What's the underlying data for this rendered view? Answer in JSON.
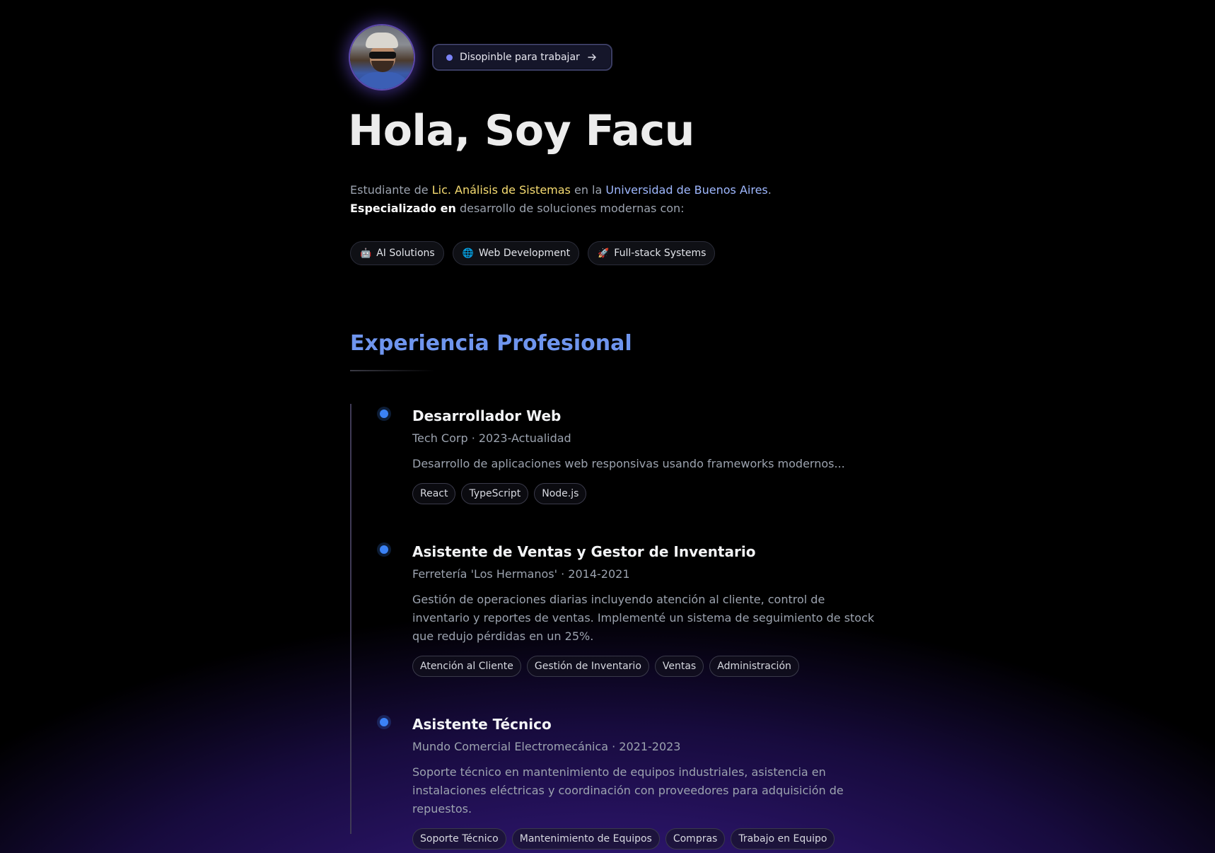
{
  "header": {
    "status_text": "Disopinble para trabajar",
    "title": "Hola, Soy Facu"
  },
  "intro": {
    "p1": "Estudiante de ",
    "degree": "Lic. Análisis de Sistemas",
    "p2": " en la ",
    "university": "Universidad de Buenos Aires",
    "p3": ". ",
    "specialized": "Especializado en",
    "p4": " desarrollo de soluciones modernas con:"
  },
  "skills": [
    {
      "emoji": "🤖",
      "label": "AI Solutions"
    },
    {
      "emoji": "🌐",
      "label": "Web Development"
    },
    {
      "emoji": "🚀",
      "label": "Full-stack Systems"
    }
  ],
  "experience": {
    "title": "Experiencia Profesional",
    "items": [
      {
        "title": "Desarrollador Web",
        "meta": "Tech Corp · 2023-Actualidad",
        "description": "Desarrollo de aplicaciones web responsivas usando frameworks modernos...",
        "tags": [
          "React",
          "TypeScript",
          "Node.js"
        ]
      },
      {
        "title": "Asistente de Ventas y Gestor de Inventario",
        "meta": "Ferretería 'Los Hermanos' · 2014-2021",
        "description": "Gestión de operaciones diarias incluyendo atención al cliente, control de inventario y reportes de ventas. Implementé un sistema de seguimiento de stock que redujo pérdidas en un 25%.",
        "tags": [
          "Atención al Cliente",
          "Gestión de Inventario",
          "Ventas",
          "Administración"
        ]
      },
      {
        "title": "Asistente Técnico",
        "meta": "Mundo Comercial Electromecánica · 2021-2023",
        "description": "Soporte técnico en mantenimiento de equipos industriales, asistencia en instalaciones eléctricas y coordinación con proveedores para adquisición de repuestos.",
        "tags": [
          "Soporte Técnico",
          "Mantenimiento de Equipos",
          "Compras",
          "Trabajo en Equipo"
        ]
      }
    ]
  },
  "colors": {
    "accent_blue": "#6f95ee",
    "highlight_yellow": "#f7dd72",
    "highlight_blue": "#9fb8ff",
    "timeline_dot": "#3b82f6",
    "status_dot": "#7b83f6"
  },
  "icons": {
    "status_arrow": "arrow-right-icon"
  }
}
